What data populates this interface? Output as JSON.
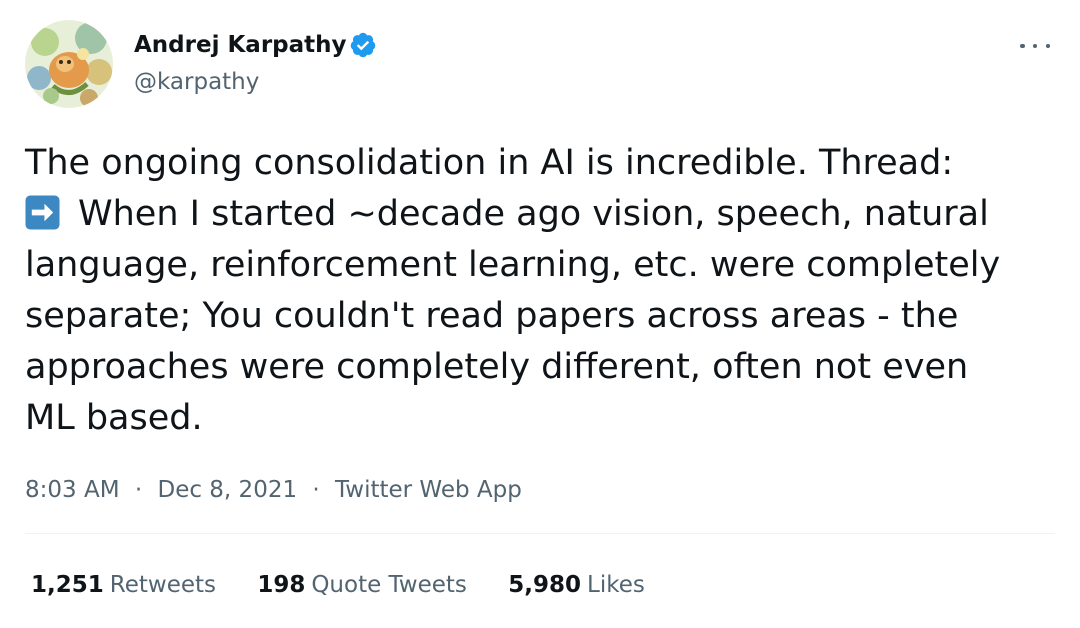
{
  "author": {
    "name": "Andrej Karpathy",
    "handle": "@karpathy",
    "verified": true
  },
  "tweet": {
    "lines": [
      "The ongoing consolidation in AI is incredible. Thread:",
      "When I started ~decade ago vision, speech, natural",
      "language, reinforcement learning, etc. were completely",
      "separate; You couldn't read papers across areas - the",
      "approaches were completely different, often not even",
      "ML based."
    ],
    "emoji": "right-arrow-emoji"
  },
  "meta": {
    "time": "8:03 AM",
    "separator": "·",
    "date": "Dec 8, 2021",
    "source": "Twitter Web App"
  },
  "stats": {
    "retweets": {
      "count": "1,251",
      "label": "Retweets"
    },
    "quote_tweets": {
      "count": "198",
      "label": "Quote Tweets"
    },
    "likes": {
      "count": "5,980",
      "label": "Likes"
    }
  },
  "colors": {
    "text": "#0f1419",
    "secondary": "#536471",
    "verified_blue": "#1d9bf0",
    "emoji_blue": "#3b88c3"
  }
}
